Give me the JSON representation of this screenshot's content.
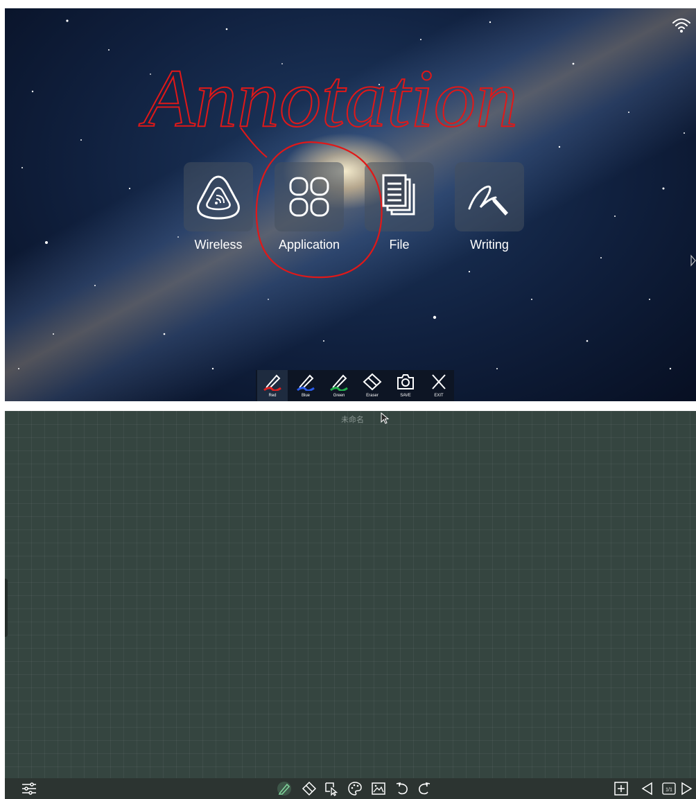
{
  "launcher": {
    "annotation_text": "Annotation",
    "tiles": [
      {
        "label": "Wireless",
        "icon": "wireless-icon"
      },
      {
        "label": "Application",
        "icon": "application-grid-icon"
      },
      {
        "label": "File",
        "icon": "file-icon"
      },
      {
        "label": "Writing",
        "icon": "writing-pen-icon"
      }
    ],
    "status_icon": "wifi-icon"
  },
  "annotation_toolbar": {
    "tools": [
      {
        "label": "Red",
        "icon": "pen-icon",
        "color": "#e02020",
        "active": true
      },
      {
        "label": "Blue",
        "icon": "pen-icon",
        "color": "#2a5be8"
      },
      {
        "label": "Green",
        "icon": "pen-icon",
        "color": "#22b14c"
      },
      {
        "label": "Eraser",
        "icon": "eraser-icon"
      },
      {
        "label": "SAVE",
        "icon": "camera-icon"
      },
      {
        "label": "EXIT",
        "icon": "close-icon"
      }
    ]
  },
  "whiteboard": {
    "title": "未命名",
    "background_color": "#354540",
    "toolbar": {
      "left": [
        "settings-sliders-icon"
      ],
      "center": [
        "pen-icon",
        "eraser-icon",
        "select-icon",
        "palette-icon",
        "image-icon",
        "undo-icon",
        "redo-icon"
      ],
      "right": [
        "add-page-icon",
        "prev-page-icon",
        "page-indicator-icon",
        "next-page-icon"
      ]
    },
    "page_indicator": "1/1"
  }
}
